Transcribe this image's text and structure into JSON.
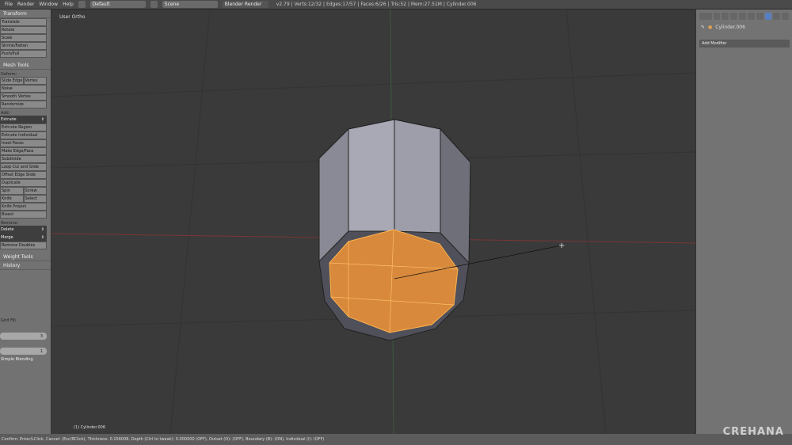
{
  "topbar": {
    "menus": [
      "File",
      "Render",
      "Window",
      "Help"
    ],
    "layout": "Default",
    "scene": "Scene",
    "engine": "Blender Render",
    "info": "v2.79 | Verts:12/32 | Edges:17/57 | Faces:6/26 | Tris:52 | Mem:27.51M | Cylinder.006"
  },
  "left": {
    "transform_header": "Transform",
    "transform": [
      "Translate",
      "Rotate",
      "Scale",
      "Shrink/Fatten",
      "Push/Pull"
    ],
    "mesh_tools_header": "Mesh Tools",
    "deform_label": "Deform:",
    "slide_edge": "Slide Edge",
    "vertex": "Vertex",
    "noise": "Noise",
    "smooth_vertex": "Smooth Vertex",
    "randomize": "Randomize",
    "add_label": "Add:",
    "extrude": "Extrude",
    "add": [
      "Extrude Region",
      "Extrude Individual",
      "Inset Faces",
      "Make Edge/Face",
      "Subdivide",
      "Loop Cut and Slide",
      "Offset Edge Slide",
      "Duplicate"
    ],
    "spin": "Spin",
    "screw": "Screw",
    "knife": "Knife",
    "select": "Select",
    "knife_project": "Knife Project",
    "bisect": "Bisect",
    "remove_label": "Remove:",
    "delete": "Delete",
    "merge": "Merge",
    "remove_doubles": "Remove Doubles",
    "weight_tools": "Weight Tools",
    "history": "History",
    "fill": "Grid Fill",
    "span_value": "3",
    "offset_value": "1",
    "simple_blending": "Simple Blending"
  },
  "viewport": {
    "label": "User Ortho",
    "object": "(1) Cylinder.006"
  },
  "right": {
    "object": "Cylinder.006",
    "add_modifier": "Add Modifier"
  },
  "status": "Confirm: Enter/LClick, Cancel: (Esc/RClick), Thickness: 0.156008, Depth (Ctrl to tweak): 0.000000 (OFF), Outset (O): (OFF), Boundary (B): (ON), Individual (I): (OFF)",
  "brand": "CREHANA"
}
